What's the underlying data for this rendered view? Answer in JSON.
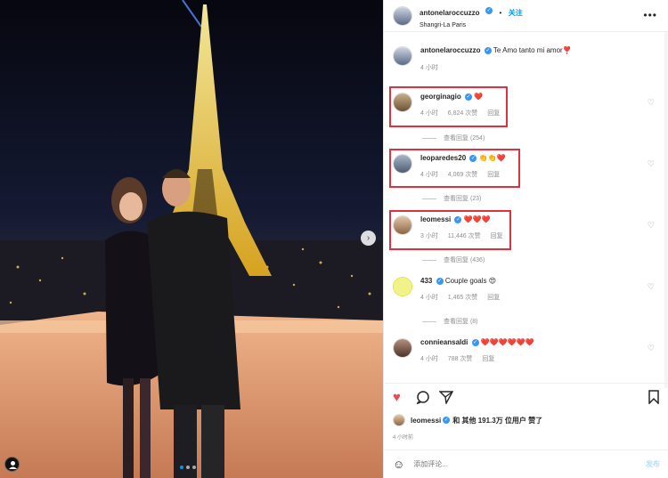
{
  "header": {
    "username": "antonelaroccuzzo",
    "follow_label": "关注",
    "location": "Shangri-La Paris",
    "dot": "•"
  },
  "caption": {
    "username": "antonelaroccuzzo",
    "text": "Te Amo tanto mi amor❣️",
    "time": "4 小时"
  },
  "comments": [
    {
      "username": "georginagio",
      "text": "❤️",
      "time": "4 小时",
      "likes": "6,824 次赞",
      "reply": "回复",
      "view_replies": "查看回复 (254)",
      "highlighted": true
    },
    {
      "username": "leoparedes20",
      "text": "👏👏❤️",
      "time": "4 小时",
      "likes": "4,069 次赞",
      "reply": "回复",
      "view_replies": "查看回复 (23)",
      "highlighted": true
    },
    {
      "username": "leomessi",
      "text": "❤️❤️❤️",
      "time": "3 小时",
      "likes": "11,446 次赞",
      "reply": "回复",
      "view_replies": "查看回复 (436)",
      "highlighted": true
    },
    {
      "username": "433",
      "text": "Couple goals 😍",
      "time": "4 小时",
      "likes": "1,465 次赞",
      "reply": "回复",
      "view_replies": "查看回复 (8)",
      "highlighted": false
    },
    {
      "username": "connieansaldi",
      "text": "❤️❤️❤️❤️❤️❤️",
      "time": "4 小时",
      "likes": "788 次赞",
      "reply": "回复",
      "view_replies": "",
      "highlighted": false
    }
  ],
  "likes_line": {
    "user": "leomessi",
    "rest": "和 其他 191.3万 位用户 赞了"
  },
  "post_time": "4 小时前",
  "add_comment": {
    "placeholder": "添加评论...",
    "post_label": "发布"
  },
  "colors": {
    "accent": "#0095f6",
    "like_red": "#ed4956",
    "highlight_box": "#e0323e"
  },
  "icons": [
    "heart-icon",
    "comment-icon",
    "share-icon",
    "bookmark-icon",
    "smile-icon",
    "more-icon",
    "next-arrow-icon",
    "tag-user-icon"
  ]
}
